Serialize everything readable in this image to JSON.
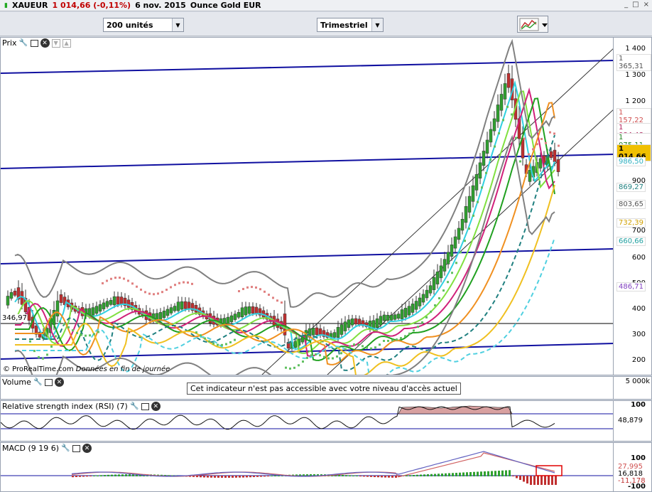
{
  "header": {
    "symbol": "XAUEUR",
    "price_change": "1 014,66 (-0,11%)",
    "date": "6 nov. 2015",
    "instrument": "Ounce Gold EUR",
    "window_buttons": [
      "_",
      "□",
      "×"
    ]
  },
  "toolbar": {
    "units_value": "200 unités",
    "period_value": "Trimestriel"
  },
  "price_panel": {
    "label": "Prix",
    "left_value": "346,97",
    "footer_source": "© ProRealTime.com",
    "footer_note": "Données en fin de journée",
    "ticks": [
      "1 400",
      "1 300",
      "1 200",
      "900",
      "700",
      "600",
      "500",
      "400",
      "300",
      "200"
    ],
    "tags": [
      {
        "text": "1 365,31",
        "color": "#555555"
      },
      {
        "text": "1 157,22",
        "color": "#d05050"
      },
      {
        "text": "1 084,48",
        "color": "#b0205a"
      },
      {
        "text": "1 075,11",
        "color": "#208020"
      },
      {
        "text": "1 014,66",
        "color": "#000000",
        "bg": "#f0c000"
      },
      {
        "text": "986,50",
        "color": "#30b0c0"
      },
      {
        "text": "869,27",
        "color": "#208080"
      },
      {
        "text": "803,65",
        "color": "#555555"
      },
      {
        "text": "732,39",
        "color": "#d0a000"
      },
      {
        "text": "660,66",
        "color": "#20a0a0"
      },
      {
        "text": "486,71",
        "color": "#8040c0"
      }
    ]
  },
  "volume_panel": {
    "label": "Volume",
    "notice": "Cet indicateur n'est pas accessible avec votre niveau d'accès actuel",
    "tick": "5 000k"
  },
  "rsi_panel": {
    "label": "Relative strength index (RSI) (7)",
    "tick": "100",
    "value": "48,879"
  },
  "macd_panel": {
    "label": "MACD (9 19 6)",
    "tick": "100",
    "values": [
      "27,995",
      "16,818",
      "-11,178"
    ],
    "bottom_tick": "-100"
  },
  "colors": {
    "channel": "#1010a0",
    "up_candle": "#30a030",
    "down_candle": "#c03030",
    "ma_magenta": "#d0207a",
    "ma_green": "#20a020",
    "ma_orange": "#f09020",
    "ma_cyan": "#30d0e0",
    "bollinger": "#808080",
    "sar": "#e08080"
  }
}
